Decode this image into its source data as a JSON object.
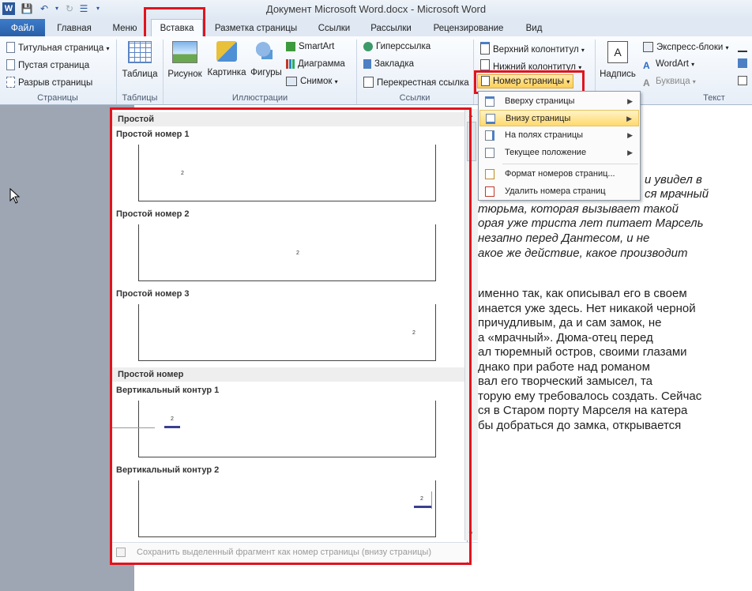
{
  "titlebar": {
    "title": "Документ Microsoft Word.docx  -  Microsoft Word",
    "word_icon": "W"
  },
  "tabs": {
    "file": "Файл",
    "items": [
      "Главная",
      "Меню",
      "Вставка",
      "Разметка страницы",
      "Ссылки",
      "Рассылки",
      "Рецензирование",
      "Вид"
    ]
  },
  "ribbon": {
    "pages": {
      "label": "Страницы",
      "items": [
        "Титульная страница",
        "Пустая страница",
        "Разрыв страницы"
      ]
    },
    "tables": {
      "label": "Таблицы",
      "table": "Таблица"
    },
    "illustrations": {
      "label": "Иллюстрации",
      "picture": "Рисунок",
      "clipart": "Картинка",
      "shapes": "Фигуры",
      "smartart": "SmartArt",
      "chart": "Диаграмма",
      "screenshot": "Снимок"
    },
    "links": {
      "label": "Ссылки",
      "items": [
        "Гиперссылка",
        "Закладка",
        "Перекрестная ссылка"
      ]
    },
    "header_footer": {
      "header": "Верхний колонтитул",
      "footer": "Нижний колонтитул",
      "page_number": "Номер страницы"
    },
    "text": {
      "label": "Текст",
      "textbox": "Надпись",
      "quickparts": "Экспресс-блоки",
      "wordart": "WordArt",
      "dropcap": "Буквица"
    }
  },
  "submenu": {
    "items": [
      "Вверху страницы",
      "Внизу страницы",
      "На полях страницы",
      "Текущее положение",
      "Формат номеров страниц...",
      "Удалить номера страниц"
    ],
    "highlighted": "Внизу страницы"
  },
  "gallery": {
    "section1": "Простой",
    "items1": [
      "Простой номер 1",
      "Простой номер 2",
      "Простой номер 3"
    ],
    "section2": "Простой номер",
    "items2": [
      "Вертикальный контур 1",
      "Вертикальный контур 2"
    ],
    "page_num_glyph": "2",
    "footer": "Сохранить выделенный фрагмент как номер страницы (внизу страницы)"
  },
  "document": {
    "italic_lines": [
      "и увидел в",
      "ся мрачный",
      "тюрьма, которая вызывает такой",
      "орая уже триста лет питает Марсель",
      "незапно перед Дантесом, и не",
      "акое же действие, какое производит"
    ],
    "lines": [
      "именно так, как описывал его в своем",
      "инается уже здесь. Нет никакой черной",
      "причудливым, да и сам замок, не",
      "а «мрачный». Дюма-отец перед",
      "ал тюремный остров, своими глазами",
      "днако при работе над романом",
      "вал его творческий замысел, та",
      "торую ему требовалось создать.  Сейчас",
      "ся в Старом порту Марселя на катера",
      "бы добраться до замка, открывается"
    ]
  },
  "colors": {
    "highlight_box": "#e0141e",
    "file_tab": "#2a5fa8"
  }
}
